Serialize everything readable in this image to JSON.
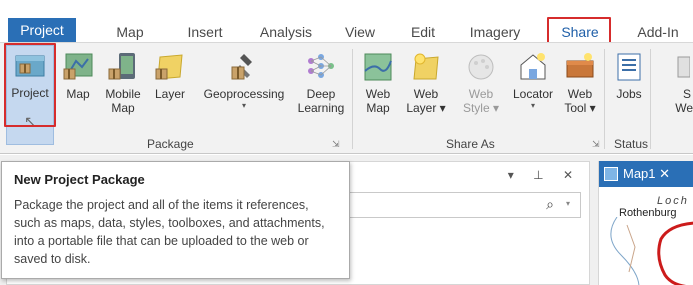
{
  "tabs": [
    {
      "label": "Project"
    },
    {
      "label": "Map"
    },
    {
      "label": "Insert"
    },
    {
      "label": "Analysis"
    },
    {
      "label": "View"
    },
    {
      "label": "Edit"
    },
    {
      "label": "Imagery"
    },
    {
      "label": "Share"
    },
    {
      "label": "Add-In"
    }
  ],
  "active_tab": "Project",
  "highlighted_tab": "Share",
  "ribbon": {
    "package_group": {
      "label": "Package",
      "buttons": [
        {
          "label": "Project",
          "icon": "project-package-icon"
        },
        {
          "label": "Map",
          "icon": "map-package-icon"
        },
        {
          "label": "Mobile Map",
          "line1": "Mobile",
          "line2": "Map",
          "icon": "mobile-map-package-icon"
        },
        {
          "label": "Layer",
          "icon": "layer-package-icon"
        },
        {
          "label": "Geoprocessing",
          "arrow": "▾",
          "icon": "geoprocessing-package-icon"
        },
        {
          "label": "Deep Learning",
          "line1": "Deep",
          "line2": "Learning",
          "icon": "deep-learning-package-icon"
        }
      ]
    },
    "share_as_group": {
      "label": "Share As",
      "buttons": [
        {
          "label": "Web Map",
          "line1": "Web",
          "line2": "Map",
          "icon": "web-map-icon"
        },
        {
          "label": "Web Layer",
          "line1": "Web",
          "line2": "Layer ▾",
          "icon": "web-layer-icon"
        },
        {
          "label": "Web Style",
          "line1": "Web",
          "line2": "Style ▾",
          "icon": "web-style-icon",
          "disabled": true
        },
        {
          "label": "Locator",
          "arrow": "▾",
          "icon": "locator-icon"
        },
        {
          "label": "Web Tool",
          "line1": "Web",
          "line2": "Tool ▾",
          "icon": "web-tool-icon"
        }
      ]
    },
    "status_group": {
      "label": "Status",
      "buttons": [
        {
          "label": "Jobs",
          "icon": "jobs-icon"
        }
      ]
    },
    "partial_button": {
      "line1": "S",
      "line2": "We"
    }
  },
  "pane": {
    "controls": "▾ ⊥ ✕",
    "search_icon": "⌕",
    "search_caret": "▾"
  },
  "map_pane": {
    "tab_label": "Map1 ✕",
    "text_lines": [
      "Loch",
      "Rothenburg"
    ]
  },
  "tooltip": {
    "title": "New Project Package",
    "body": "Package the project and all of the items it references, such as maps, data, styles, toolboxes, and attachments, into a portable file that can be uploaded to the web or saved to disk."
  },
  "colors": {
    "accent": "#2a6fb6",
    "highlight": "#d62c2c",
    "selected": "#c5d8ef"
  }
}
